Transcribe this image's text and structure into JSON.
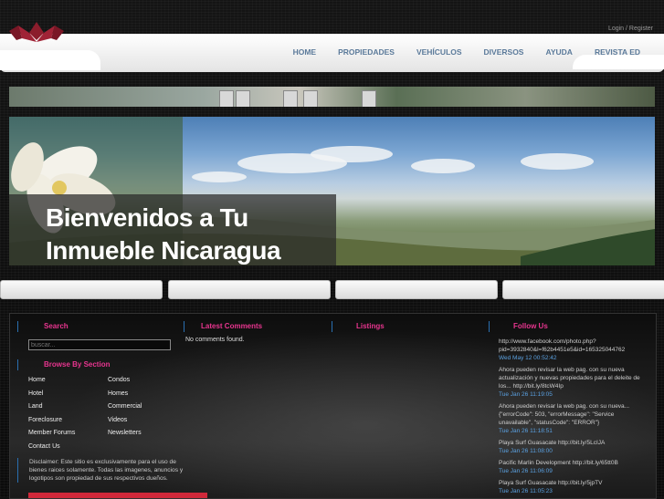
{
  "login": {
    "login_label": "Login",
    "separator": " / ",
    "register_label": "Register"
  },
  "nav": {
    "items": [
      "HOME",
      "PROPIEDADES",
      "VEHÍCULOS",
      "DIVERSOS",
      "AYUDA",
      "REVISTA ED"
    ]
  },
  "logo": {
    "icon": "lotus-logo-icon",
    "brand_color": "#8b1d2c"
  },
  "banner": {
    "title_line1": "Bienvenidos a Tu",
    "title_line2": "Inmueble Nicaragua"
  },
  "sidebar": {
    "search_title": "Search",
    "search_placeholder": "buscar...",
    "browse_title": "Browse By Section",
    "sections_left": [
      "Home",
      "Hotel",
      "Land",
      "Foreclosure",
      "Member Forums",
      "Contact Us"
    ],
    "sections_right": [
      "Condos",
      "Homes",
      "Commercial",
      "Videos",
      "Newsletters"
    ],
    "disclaimer": "Disclaimer: Este sitio es exclusivamente para el uso de bienes raices solamente. Todas las imagenes, anuncios y logotipos son propiedad de sus respectivos dueños."
  },
  "comments": {
    "title": "Latest Comments",
    "empty_text": "No comments found."
  },
  "listings": {
    "title": "Listings"
  },
  "follow": {
    "title": "Follow Us",
    "items": [
      {
        "text": "http://www.facebook.com/photo.php?pid=3932840&l=f62b4451e5&id=165325044762",
        "time": "Wed May 12 00:52:42"
      },
      {
        "text": "Ahora pueden revisar la web pag. con su nueva actualización y nuevas propiedades para el deleite de los... http://bit.ly/8tcW4Ip",
        "time": "Tue Jan 26 11:19:05"
      },
      {
        "text": "Ahora pueden revisar la web pag. con su nueva... {\"errorCode\": 503, \"errorMessage\": \"Service unavailable\", \"statusCode\": \"ERROR\"}",
        "time": "Tue Jan 26 11:18:51"
      },
      {
        "text": "Playa Surf Guasacate http://bit.ly/5LcIJA",
        "time": "Tue Jan 26 11:08:00"
      },
      {
        "text": "Pacific Marlin Development http://bit.ly/65tt0B",
        "time": "Tue Jan 26 11:06:09"
      },
      {
        "text": "Playa Surf Guasacate http://bit.ly/5jpTV",
        "time": "Tue Jan 26 11:05:23"
      }
    ]
  },
  "colors": {
    "accent_pink": "#e8358f",
    "link_blue": "#5aa0e0",
    "nav_blue": "#5b7a9a",
    "divider_blue": "#2a6fb0"
  }
}
